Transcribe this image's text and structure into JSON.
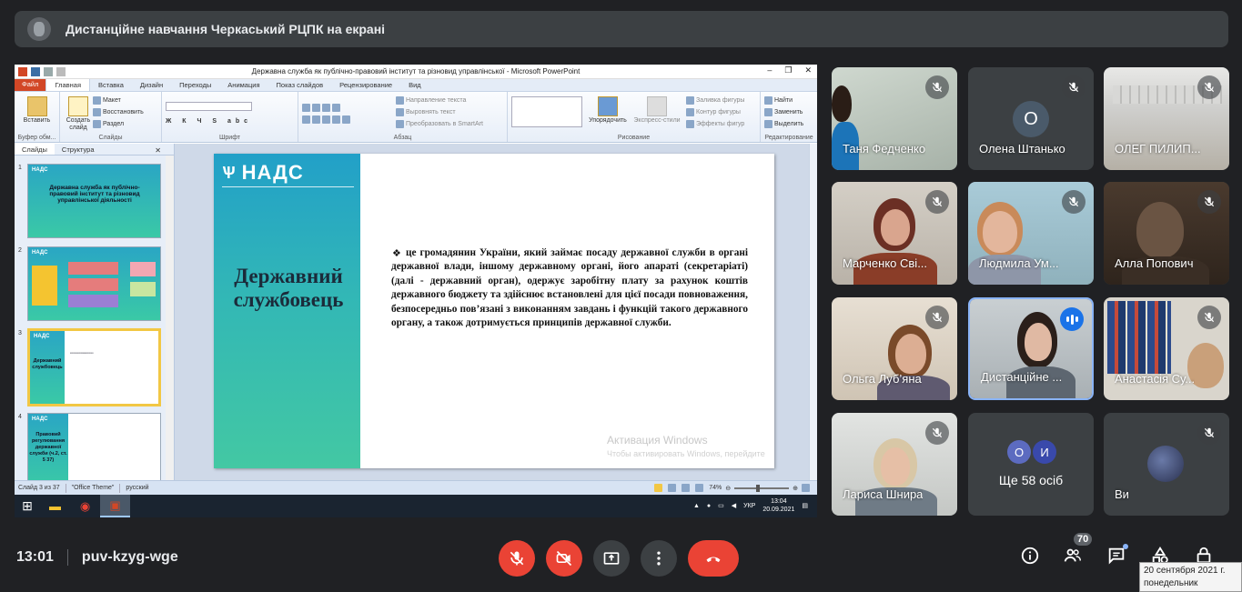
{
  "meeting": {
    "banner_title": "Дистанційне навчання Черкаський РЦПК на екрані",
    "time": "13:01",
    "code": "puv-kzyg-wge",
    "participants_count": "70"
  },
  "ppt": {
    "window_title": "Державна служба як публічно-правовий інститут та різновид управлінської - Microsoft PowerPoint",
    "file_tab": "Файл",
    "tabs": [
      "Главная",
      "Вставка",
      "Дизайн",
      "Переходы",
      "Анимация",
      "Показ слайдов",
      "Рецензирование",
      "Вид"
    ],
    "ribbon": {
      "insert_label": "Вставить",
      "create_slide_label": "Создать слайд",
      "maket": "Макет",
      "restore": "Восстановить",
      "section": "Раздел",
      "buffer_group": "Буфер обм...",
      "slides_group": "Слайды",
      "font_group": "Шрифт",
      "para_group": "Абзац",
      "text_dir": "Направление текста",
      "align_text": "Выровнять текст",
      "smartart": "Преобразовать в SmartArt",
      "arrange": "Упорядочить",
      "express_styles": "Экспресс-стили",
      "fill": "Заливка фигуры",
      "outline": "Контур фигуры",
      "effects": "Эффекты фигур",
      "drawing_group": "Рисование",
      "find": "Найти",
      "replace": "Заменить",
      "select": "Выделить",
      "editing_group": "Редактирование"
    },
    "pane_tabs": [
      "Слайды",
      "Структура"
    ],
    "thumbs": [
      {
        "num": "1",
        "logo": "НАДС",
        "title": "Державна служба як публічно-правовий інститут та різновид управлінської діяльності"
      },
      {
        "num": "2",
        "logo": "НАДС",
        "title": ""
      },
      {
        "num": "3",
        "logo": "НАДС",
        "title": "Державний службовець"
      },
      {
        "num": "4",
        "logo": "НАДС",
        "title": "Правовий регулювання державної служби (ч.2, ст. 5 37)"
      }
    ],
    "slide": {
      "logo": "НАДС",
      "heading": "Державний службовець",
      "bullet_symbol": "❖",
      "body": "це громадянин України, який займає посаду державної служби в органі державної влади, іншому державному органі, його апараті (секретаріаті) (далі - державний орган), одержує заробітну плату за рахунок коштів державного бюджету та здійснює встановлені для цієї посади повноваження, безпосередньо пов’язані з виконанням завдань і функцій такого державного органу, а також дотримується принципів державної служби.",
      "activation_title": "Активация Windows",
      "activation_text": "Чтобы активировать Windows, перейдите"
    },
    "status": {
      "slide_of": "Слайд 3 из 37",
      "theme": "\"Office Theme\"",
      "lang": "русский",
      "zoom": "74%"
    },
    "taskbar": {
      "lang": "УКР",
      "clock_time": "13:04",
      "clock_date": "20.09.2021"
    }
  },
  "participants": [
    {
      "name": "Таня Федченко",
      "muted": true
    },
    {
      "name": "Олена Штанько",
      "muted": true,
      "initial": "О"
    },
    {
      "name": "ОЛЕГ ПИЛИП...",
      "muted": true
    },
    {
      "name": "Марченко Сві...",
      "muted": true
    },
    {
      "name": "Людмила Ум...",
      "muted": true
    },
    {
      "name": "Алла Попович",
      "muted": true
    },
    {
      "name": "Ольга Луб’яна",
      "muted": true
    },
    {
      "name": "Дистанційне ...",
      "muted": false
    },
    {
      "name": "Анастасія Су...",
      "muted": true
    },
    {
      "name": "Лариса Шнира",
      "muted": true
    },
    {
      "name": "Ще 58 осіб",
      "avatars": [
        "О",
        "И"
      ]
    },
    {
      "name": "Ви",
      "muted": true
    }
  ],
  "tooltip": {
    "date": "20 сентября 2021 г.",
    "day": "понедельник"
  },
  "colors": {
    "bg": "#202124",
    "red": "#ea4335",
    "speaking": "#8ab4f8",
    "slide_panel": "#32b7b6"
  }
}
